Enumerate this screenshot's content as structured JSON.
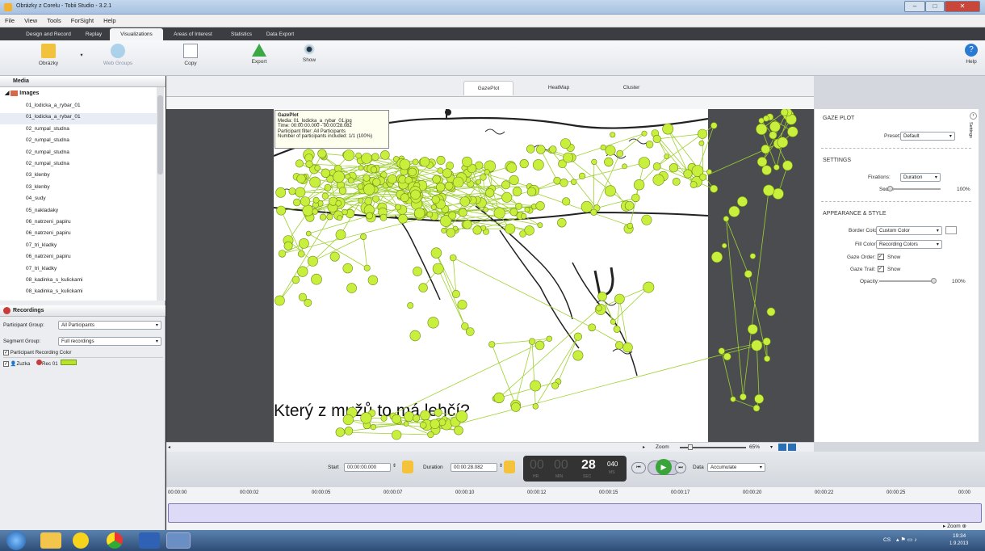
{
  "window": {
    "title": "Obrázky z Corelu - Tobii Studio - 3.2.1"
  },
  "menu": [
    "File",
    "View",
    "Tools",
    "ForSight",
    "Help"
  ],
  "ribbon_tabs": [
    "Design and Record",
    "Replay",
    "Visualizations",
    "Areas of Interest",
    "Statistics",
    "Data Export"
  ],
  "ribbon": {
    "obrazky": "Obrázky",
    "web_groups": "Web Groups",
    "copy": "Copy",
    "export": "Export",
    "show": "Show",
    "help": "Help"
  },
  "media": {
    "header": "Media",
    "images_label": "Images",
    "items": [
      "01_lodicka_a_rybar_01",
      "01_lodicka_a_rybar_01",
      "02_rumpal_studna",
      "02_rumpal_studna",
      "02_rumpal_studna",
      "02_rumpal_studna",
      "03_klenby",
      "03_klenby",
      "04_sudy",
      "05_nakladaky",
      "06_natrzeni_papiru",
      "06_natrzeni_papiru",
      "07_tri_kladky",
      "06_natrzeni_papiru",
      "07_tri_kladky",
      "08_kadinka_s_kulickami",
      "08_kadinka_s_kulickami"
    ]
  },
  "recordings": {
    "header": "Recordings",
    "participant_group_label": "Participant Group:",
    "participant_group_value": "All Participants",
    "segment_group_label": "Segment Group:",
    "segment_group_value": "Full recordings",
    "cols": [
      "Participant",
      "Recording",
      "Color"
    ],
    "row": {
      "participant": "Zuzka",
      "recording": "Rec 01"
    }
  },
  "viz_tabs": [
    "GazePlot",
    "HeatMap",
    "Cluster"
  ],
  "tooltip": {
    "title": "GazePlot",
    "media": "Media: 01_lodicka_a_rybar_01.jpg",
    "time": "Time: 00:00:00.000 - 00:00:28.082",
    "filter": "Participant filter: All Participants",
    "included": "Number of participants included: 1/1 (100%)"
  },
  "stimulus_text": "Který z mužů to má lehčí?",
  "gaze_plot": {
    "header": "GAZE PLOT",
    "preset_label": "Preset:",
    "preset_value": "Default",
    "settings_header": "SETTINGS",
    "fixations_label": "Fixations:",
    "fixations_value": "Duration",
    "scale_label": "Scale:",
    "scale_value": "100%",
    "appearance_header": "APPEARANCE & STYLE",
    "border_color_label": "Border Color:",
    "border_color_value": "Custom Color",
    "fill_color_label": "Fill Color:",
    "fill_color_value": "Recording Colors",
    "gaze_order_label": "Gaze Order:",
    "gaze_order_value": "Show",
    "gaze_trail_label": "Gaze Trail:",
    "gaze_trail_value": "Show",
    "opacity_label": "Opacity:",
    "opacity_value": "100%",
    "settings_side": "Settings"
  },
  "zoom": {
    "label": "Zoom",
    "value": "65%"
  },
  "player": {
    "start_label": "Start",
    "start_value": "00:00:00.000",
    "duration_label": "Duration",
    "duration_value": "00:00:28.082",
    "clock_hr": "00",
    "clock_min": "00",
    "clock_sec": "28",
    "clock_ms": "040",
    "clock_hr_label": "HR",
    "clock_min_label": "MIN",
    "clock_sec_label": "SEC",
    "clock_ms_label": "MS",
    "data_label": "Data",
    "data_value": "Accumulate"
  },
  "timeline": {
    "ticks": [
      "00:00:00",
      "00:00:02",
      "00:00:05",
      "00:00:07",
      "00:00:10",
      "00:00:12",
      "00:00:15",
      "00:00:17",
      "00:00:20",
      "00:00:22",
      "00:00:25",
      "00:00"
    ],
    "zoom_label": "Zoom"
  },
  "taskbar": {
    "lang": "CS",
    "time": "19:34",
    "date": "1.9.2013"
  },
  "colors": {
    "fixation_fill": "#c8ef3c",
    "fixation_border": "#6e8a18",
    "record_color": "#b7e32c",
    "accent": "#2a7ad2"
  }
}
